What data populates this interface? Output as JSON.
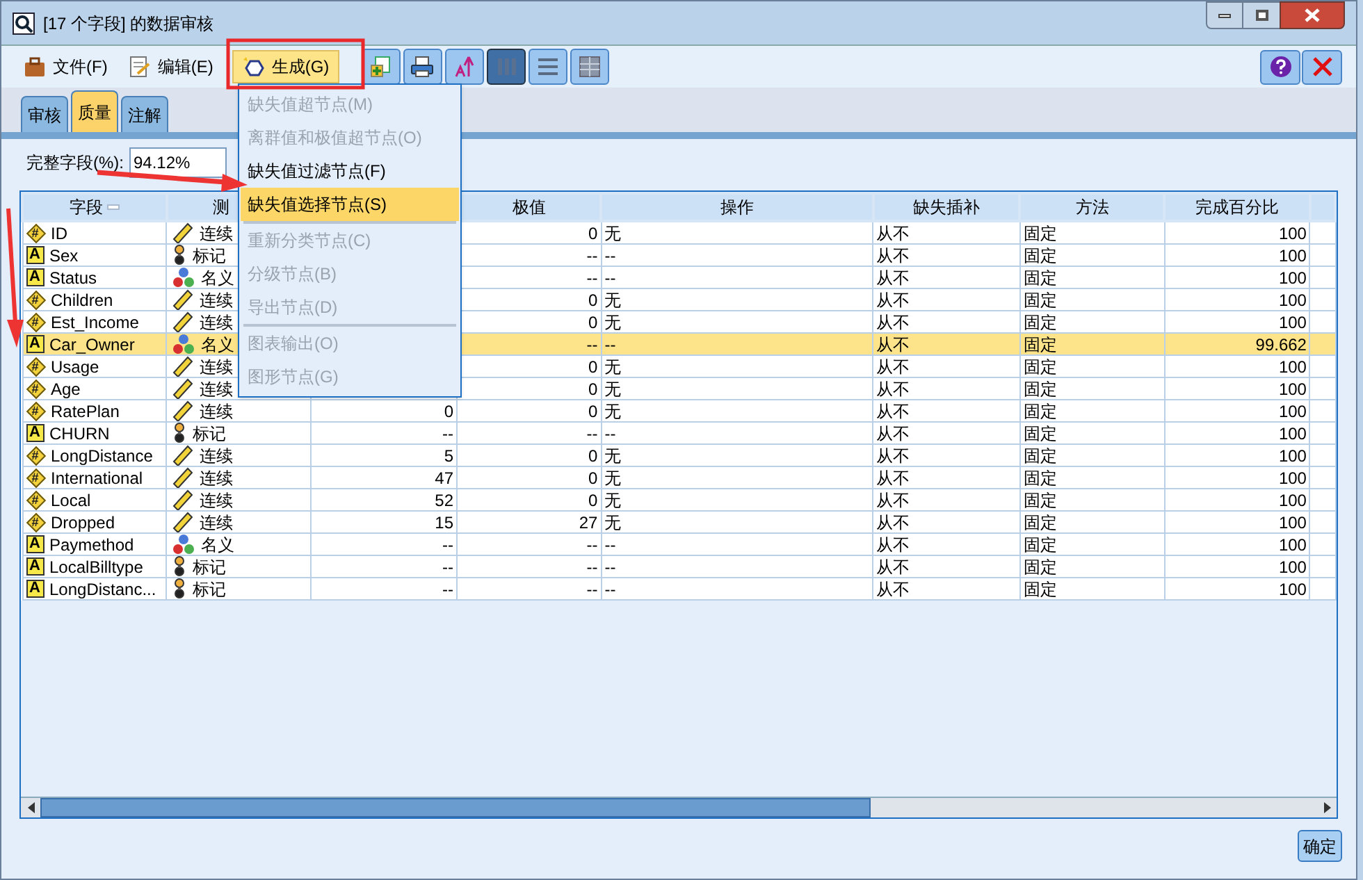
{
  "window": {
    "title": "[17 个字段] 的数据审核"
  },
  "menubar": [
    {
      "label": "文件(F)",
      "selected": false
    },
    {
      "label": "编辑(E)",
      "selected": false
    },
    {
      "label": "生成(G)",
      "selected": true
    }
  ],
  "toolbar": [
    {
      "selected": false
    },
    {
      "selected": false
    },
    {
      "selected": false
    },
    {
      "selected": true
    },
    {
      "selected": false
    },
    {
      "selected": false
    }
  ],
  "tabs": [
    {
      "label": "审核",
      "selected": false
    },
    {
      "label": "质量",
      "selected": true
    },
    {
      "label": "注解",
      "selected": false
    }
  ],
  "complete_fields": {
    "label": "完整字段(%):",
    "value": "94.12%"
  },
  "generate_menu": [
    {
      "label": "缺失值超节点(M)",
      "disabled": true,
      "selected": false
    },
    {
      "label": "离群值和极值超节点(O)",
      "disabled": true,
      "selected": false
    },
    {
      "label": "缺失值过滤节点(F)",
      "disabled": false,
      "selected": false
    },
    {
      "label": "缺失值选择节点(S)",
      "disabled": false,
      "selected": true,
      "separator_after": true
    },
    {
      "label": "重新分类节点(C)",
      "disabled": true,
      "selected": false
    },
    {
      "label": "分级节点(B)",
      "disabled": true,
      "selected": false
    },
    {
      "label": "导出节点(D)",
      "disabled": true,
      "selected": false,
      "separator_after": true
    },
    {
      "label": "图表输出(O)",
      "disabled": true,
      "selected": false
    },
    {
      "label": "图形节点(G)",
      "disabled": true,
      "selected": false
    }
  ],
  "table": {
    "columns": [
      "字段",
      "测",
      "",
      "极值",
      "操作",
      "缺失插补",
      "方法",
      "完成百分比"
    ],
    "rows": [
      {
        "kind": "numeric",
        "glyph": "#",
        "field": "ID",
        "measure": {
          "kind": "continuous",
          "label": "连续"
        },
        "extremes": "0",
        "action": "无",
        "impute": "从不",
        "method": "固定",
        "percent": "100",
        "selected": false
      },
      {
        "kind": "string",
        "glyph": "A",
        "field": "Sex",
        "measure": {
          "kind": "flag",
          "label": "标记"
        },
        "extremes": "--",
        "action": "--",
        "impute": "从不",
        "method": "固定",
        "percent": "100",
        "selected": false
      },
      {
        "kind": "string",
        "glyph": "A",
        "field": "Status",
        "measure": {
          "kind": "nominal",
          "label": "名义"
        },
        "extremes": "--",
        "action": "--",
        "impute": "从不",
        "method": "固定",
        "percent": "100",
        "selected": false
      },
      {
        "kind": "numeric",
        "glyph": "#",
        "field": "Children",
        "measure": {
          "kind": "continuous",
          "label": "连续"
        },
        "extremes": "0",
        "action": "无",
        "impute": "从不",
        "method": "固定",
        "percent": "100",
        "selected": false
      },
      {
        "kind": "numeric",
        "glyph": "#",
        "field": "Est_Income",
        "measure": {
          "kind": "continuous",
          "label": "连续"
        },
        "extremes": "0",
        "action": "无",
        "impute": "从不",
        "method": "固定",
        "percent": "100",
        "selected": false
      },
      {
        "kind": "string",
        "glyph": "A",
        "field": "Car_Owner",
        "measure": {
          "kind": "nominal",
          "label": "名义"
        },
        "extremes": "--",
        "action": "--",
        "impute": "从不",
        "method": "固定",
        "percent": "99.662",
        "selected": true
      },
      {
        "kind": "numeric",
        "glyph": "#",
        "field": "Usage",
        "measure": {
          "kind": "continuous",
          "label": "连续"
        },
        "extremes": "0",
        "action": "无",
        "impute": "从不",
        "method": "固定",
        "percent": "100",
        "selected": false
      },
      {
        "kind": "numeric",
        "glyph": "#",
        "field": "Age",
        "measure": {
          "kind": "continuous",
          "label": "连续"
        },
        "extremes": "0",
        "action": "无",
        "impute": "从不",
        "method": "固定",
        "percent": "100",
        "selected": false
      },
      {
        "kind": "numeric",
        "glyph": "#",
        "field": "RatePlan",
        "measure": {
          "kind": "continuous",
          "label": "连续"
        },
        "column_3": "0",
        "extremes": "0",
        "action": "无",
        "impute": "从不",
        "method": "固定",
        "percent": "100",
        "selected": false
      },
      {
        "kind": "string",
        "glyph": "A",
        "field": "CHURN",
        "measure": {
          "kind": "flag",
          "label": "标记"
        },
        "column_3": "--",
        "extremes": "--",
        "action": "--",
        "impute": "从不",
        "method": "固定",
        "percent": "100",
        "selected": false
      },
      {
        "kind": "numeric",
        "glyph": "#",
        "field": "LongDistance",
        "measure": {
          "kind": "continuous",
          "label": "连续"
        },
        "column_3": "5",
        "extremes": "0",
        "action": "无",
        "impute": "从不",
        "method": "固定",
        "percent": "100",
        "selected": false
      },
      {
        "kind": "numeric",
        "glyph": "#",
        "field": "International",
        "measure": {
          "kind": "continuous",
          "label": "连续"
        },
        "column_3": "47",
        "extremes": "0",
        "action": "无",
        "impute": "从不",
        "method": "固定",
        "percent": "100",
        "selected": false
      },
      {
        "kind": "numeric",
        "glyph": "#",
        "field": "Local",
        "measure": {
          "kind": "continuous",
          "label": "连续"
        },
        "column_3": "52",
        "extremes": "0",
        "action": "无",
        "impute": "从不",
        "method": "固定",
        "percent": "100",
        "selected": false
      },
      {
        "kind": "numeric",
        "glyph": "#",
        "field": "Dropped",
        "measure": {
          "kind": "continuous",
          "label": "连续"
        },
        "column_3": "15",
        "extremes": "27",
        "action": "无",
        "impute": "从不",
        "method": "固定",
        "percent": "100",
        "selected": false
      },
      {
        "kind": "string",
        "glyph": "A",
        "field": "Paymethod",
        "measure": {
          "kind": "nominal",
          "label": "名义"
        },
        "column_3": "--",
        "extremes": "--",
        "action": "--",
        "impute": "从不",
        "method": "固定",
        "percent": "100",
        "selected": false
      },
      {
        "kind": "string",
        "glyph": "A",
        "field": "LocalBilltype",
        "measure": {
          "kind": "flag",
          "label": "标记"
        },
        "column_3": "--",
        "extremes": "--",
        "action": "--",
        "impute": "从不",
        "method": "固定",
        "percent": "100",
        "selected": false
      },
      {
        "kind": "string",
        "glyph": "A",
        "field": "LongDistanc...",
        "measure": {
          "kind": "flag",
          "label": "标记"
        },
        "column_3": "--",
        "extremes": "--",
        "action": "--",
        "impute": "从不",
        "method": "固定",
        "percent": "100",
        "selected": false
      }
    ]
  },
  "ok_button": "确定"
}
